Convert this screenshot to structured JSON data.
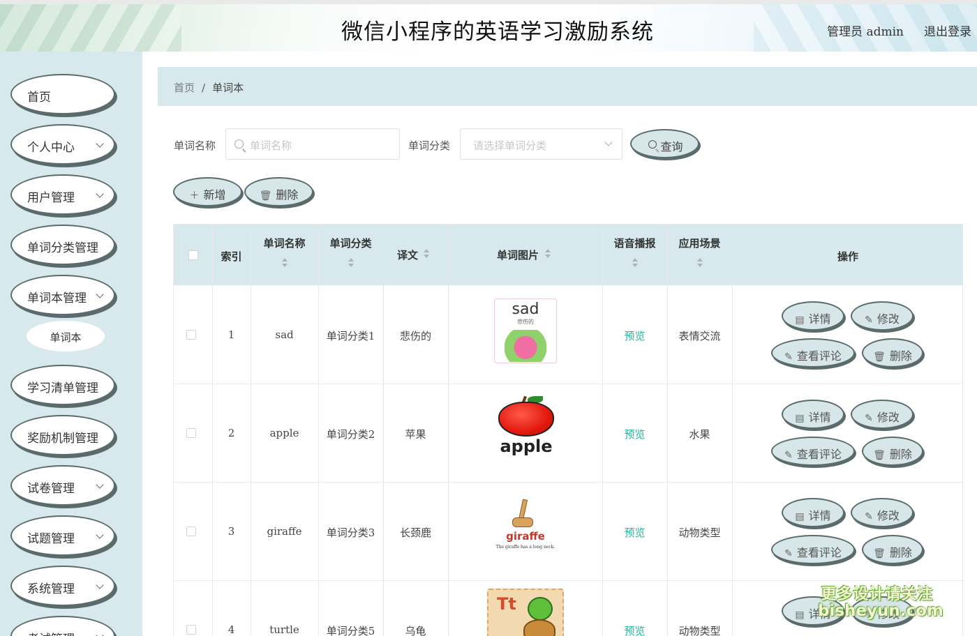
{
  "header": {
    "title": "微信小程序的英语学习激励系统",
    "user": "管理员 admin",
    "logout": "退出登录"
  },
  "sidebar": {
    "items": [
      {
        "label": "首页",
        "has_arrow": false
      },
      {
        "label": "个人中心",
        "has_arrow": true
      },
      {
        "label": "用户管理",
        "has_arrow": true
      },
      {
        "label": "单词分类管理",
        "has_arrow": true
      },
      {
        "label": "单词本管理",
        "has_arrow": true
      },
      {
        "label": "学习清单管理",
        "has_arrow": true
      },
      {
        "label": "奖励机制管理",
        "has_arrow": true
      },
      {
        "label": "试卷管理",
        "has_arrow": true
      },
      {
        "label": "试题管理",
        "has_arrow": true
      },
      {
        "label": "系统管理",
        "has_arrow": true
      },
      {
        "label": "考试管理",
        "has_arrow": true
      }
    ],
    "sub_item": "单词本"
  },
  "breadcrumb": {
    "home": "首页",
    "sep": "/",
    "current": "单词本"
  },
  "search": {
    "name_label": "单词名称",
    "name_placeholder": "单词名称",
    "category_label": "单词分类",
    "category_placeholder": "请选择单词分类",
    "query_button": "查询"
  },
  "toolbar": {
    "add_button": "新增",
    "delete_button": "删除"
  },
  "table": {
    "headers": {
      "index": "索引",
      "name": "单词名称",
      "category": "单词分类",
      "translation": "译文",
      "image": "单词图片",
      "audio": "语音播报",
      "scene": "应用场景",
      "actions": "操作"
    },
    "rows": [
      {
        "index": "1",
        "name": "sad",
        "category": "单词分类1",
        "translation": "悲伤的",
        "audio": "预览",
        "scene": "表情交流",
        "img_word": "sad",
        "img_sub": "悲伤的"
      },
      {
        "index": "2",
        "name": "apple",
        "category": "单词分类2",
        "translation": "苹果",
        "audio": "预览",
        "scene": "水果",
        "img_word": "apple",
        "img_sub": ""
      },
      {
        "index": "3",
        "name": "giraffe",
        "category": "单词分类3",
        "translation": "长颈鹿",
        "audio": "预览",
        "scene": "动物类型",
        "img_word": "giraffe",
        "img_sub": "The giraffe has a long neck."
      },
      {
        "index": "4",
        "name": "turtle",
        "category": "单词分类5",
        "translation": "乌龟",
        "audio": "预览",
        "scene": "动物类型",
        "img_word": "Tt",
        "img_sub": ""
      }
    ],
    "actions": {
      "detail": "详情",
      "edit": "修改",
      "comments": "查看评论",
      "delete": "删除"
    }
  },
  "watermark": {
    "line1": "更多设计请关注",
    "line2": "bisheyun.com"
  },
  "colors": {
    "sidebar_bg": "#d7e9ec",
    "button_bg": "#d7e6e8",
    "button_border": "#5b6b6b",
    "preview_link": "#27b39a"
  }
}
